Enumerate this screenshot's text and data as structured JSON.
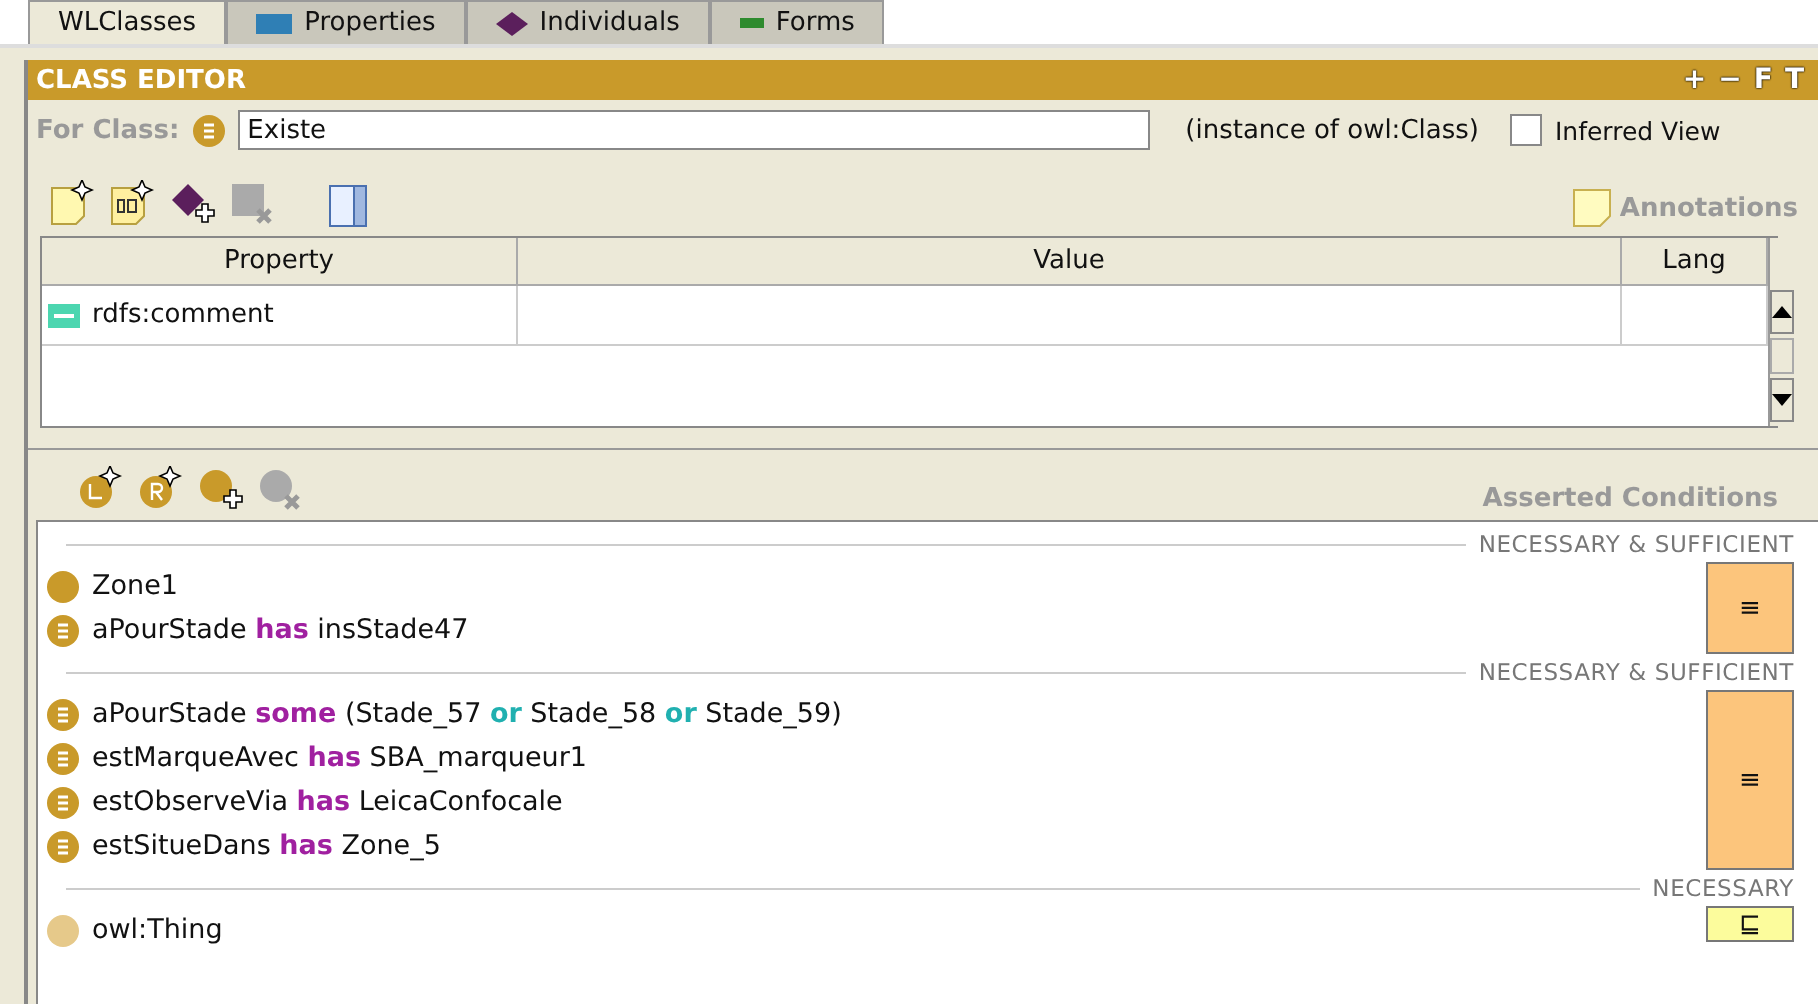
{
  "tabs": [
    {
      "label": "WLClasses",
      "kind": "classes",
      "selected": true
    },
    {
      "label": "Properties",
      "kind": "properties",
      "selected": false
    },
    {
      "label": "Individuals",
      "kind": "individuals",
      "selected": false
    },
    {
      "label": "Forms",
      "kind": "forms",
      "selected": false
    }
  ],
  "editor": {
    "title": "CLASS EDITOR",
    "header_buttons": [
      "+",
      "−",
      "F",
      "T"
    ],
    "for_class_label": "For Class:",
    "class_name": "Existe",
    "instance_of": "(instance of owl:Class)",
    "inferred_view": {
      "label": "Inferred View",
      "checked": false
    }
  },
  "annotations": {
    "title": "Annotations",
    "columns": [
      "Property",
      "Value",
      "Lang"
    ],
    "rows": [
      {
        "property": "rdfs:comment"
      }
    ]
  },
  "conditions": {
    "title": "Asserted Conditions",
    "groups": [
      {
        "label": "NECESSARY & SUFFICIENT",
        "kind": "equivalent",
        "symbol": "≡",
        "items": [
          {
            "kind": "primitive",
            "segments": [
              {
                "text": "Zone1",
                "kind": "name"
              }
            ]
          },
          {
            "kind": "defined",
            "segments": [
              {
                "text": "aPourStade ",
                "kind": "name"
              },
              {
                "text": "has",
                "kind": "quantifier"
              },
              {
                "text": " insStade47",
                "kind": "name"
              }
            ]
          }
        ]
      },
      {
        "label": "NECESSARY & SUFFICIENT",
        "kind": "equivalent",
        "symbol": "≡",
        "items": [
          {
            "kind": "defined",
            "segments": [
              {
                "text": "aPourStade ",
                "kind": "name"
              },
              {
                "text": "some",
                "kind": "quantifier"
              },
              {
                "text": " (Stade_57 ",
                "kind": "name"
              },
              {
                "text": "or",
                "kind": "operator"
              },
              {
                "text": " Stade_58 ",
                "kind": "name"
              },
              {
                "text": "or",
                "kind": "operator"
              },
              {
                "text": " Stade_59)",
                "kind": "name"
              }
            ]
          },
          {
            "kind": "defined",
            "segments": [
              {
                "text": "estMarqueAvec ",
                "kind": "name"
              },
              {
                "text": "has",
                "kind": "quantifier"
              },
              {
                "text": " SBA_marqueur1",
                "kind": "name"
              }
            ]
          },
          {
            "kind": "defined",
            "segments": [
              {
                "text": "estObserveVia ",
                "kind": "name"
              },
              {
                "text": "has",
                "kind": "quantifier"
              },
              {
                "text": " LeicaConfocale",
                "kind": "name"
              }
            ]
          },
          {
            "kind": "defined",
            "segments": [
              {
                "text": "estSitueDans ",
                "kind": "name"
              },
              {
                "text": "has",
                "kind": "quantifier"
              },
              {
                "text": " Zone_5",
                "kind": "name"
              }
            ]
          }
        ]
      },
      {
        "label": "NECESSARY",
        "kind": "necessary",
        "symbol": "⊑",
        "items": [
          {
            "kind": "thing",
            "segments": [
              {
                "text": "owl:Thing",
                "kind": "name"
              }
            ]
          }
        ]
      }
    ]
  }
}
